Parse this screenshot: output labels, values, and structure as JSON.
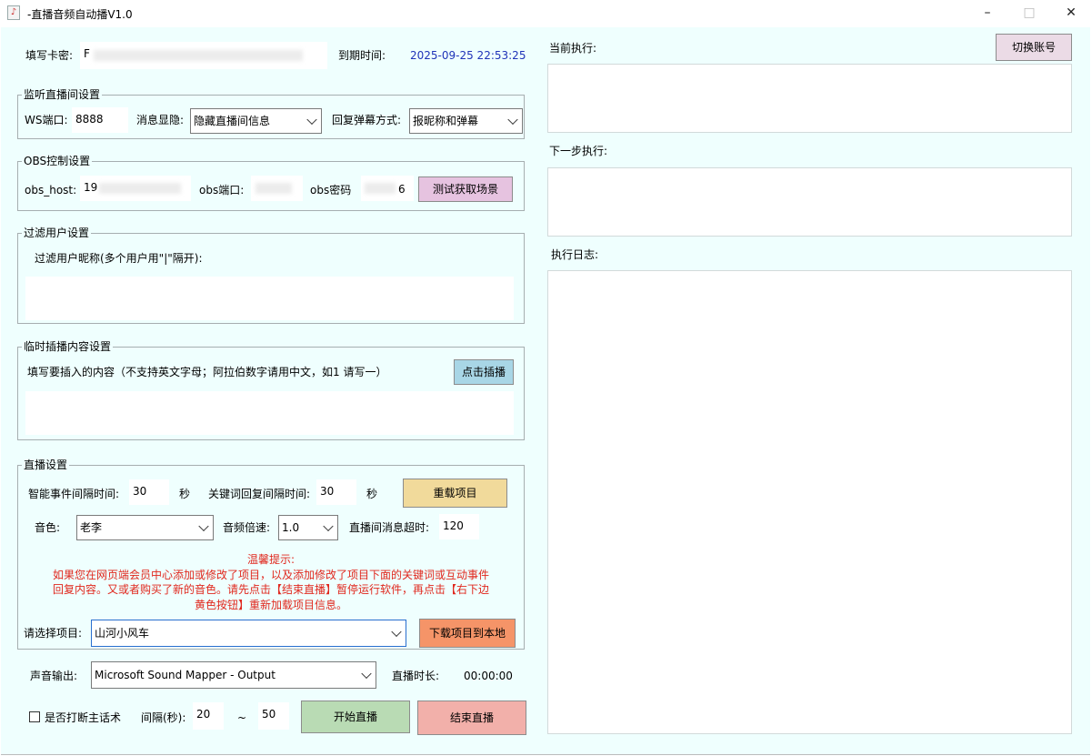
{
  "window": {
    "title": "-直播音频自动播V1.0",
    "minimize_glyph": "–",
    "maximize_glyph": "□",
    "close_glyph": "✕"
  },
  "top": {
    "card_label": "填写卡密:",
    "card_value": "F",
    "expiry_label": "到期时间:",
    "expiry_value": "2025-09-25 22:53:25"
  },
  "listen": {
    "legend": "监听直播间设置",
    "ws_label": "WS端口:",
    "ws_value": "8888",
    "privacy_label": "消息显隐:",
    "privacy_value": "隐藏直播间信息",
    "reply_label": "回复弹幕方式:",
    "reply_value": "报昵称和弹幕"
  },
  "obs": {
    "legend": "OBS控制设置",
    "host_label": "obs_host:",
    "host_value": "19",
    "port_label": "obs端口:",
    "port_value": "",
    "pwd_label": "obs密码",
    "pwd_value": "6",
    "test_button": "测试获取场景"
  },
  "filter": {
    "legend": "过滤用户设置",
    "hint": "过滤用户昵称(多个用户用\"|\"隔开):",
    "value": ""
  },
  "insert": {
    "legend": "临时插播内容设置",
    "hint": "填写要插入的内容（不支持英文字母；阿拉伯数字请用中文，如1 请写一）",
    "button": "点击插播",
    "value": ""
  },
  "live": {
    "legend": "直播设置",
    "event_interval_label": "智能事件间隔时间:",
    "event_interval_value": "30",
    "sec1": "秒",
    "kw_interval_label": "关键词回复间隔时间:",
    "kw_interval_value": "30",
    "sec2": "秒",
    "reload_button": "重载项目",
    "voice_label": "音色:",
    "voice_value": "老李",
    "speed_label": "音频倍速:",
    "speed_value": "1.0",
    "timeout_label": "直播间消息超时:",
    "timeout_value": "120",
    "tip_title": "温馨提示:",
    "tip_line1": "如果您在网页端会员中心添加或修改了项目，以及添加修改了项目下面的关键词或互动事件",
    "tip_line2": "回复内容。又或者购买了新的音色。请先点击【结束直播】暂停运行软件，再点击【右下边",
    "tip_line3": "黄色按钮】重新加载项目信息。",
    "project_label": "请选择项目:",
    "project_value": "山河小风车",
    "download_button": "下载项目到本地"
  },
  "bottom": {
    "audio_label": "声音输出:",
    "audio_value": "Microsoft Sound Mapper - Output",
    "duration_label": "直播时长:",
    "duration_value": "00:00:00",
    "interrupt_label": "是否打断主话术",
    "interval_label": "间隔(秒):",
    "interval_from": "20",
    "tilde": "~",
    "interval_to": "50",
    "start_button": "开始直播",
    "stop_button": "结束直播"
  },
  "right": {
    "switch_button": "切换账号",
    "current_label": "当前执行:",
    "current_value": "",
    "next_label": "下一步执行:",
    "next_value": "",
    "log_label": "执行日志:",
    "log_value": ""
  },
  "colors": {
    "client_bg": "#effffe",
    "expiry_text": "#1f33b8",
    "tip_text": "#e0281e",
    "test_button_bg": "#e6c3e0",
    "insert_button_bg": "#a8d6e6",
    "reload_button_bg": "#f1da9b",
    "download_button_bg": "#f59468",
    "start_button_bg": "#b9dbb4",
    "stop_button_bg": "#f2b0aa",
    "switch_button_bg": "#ebdbe6"
  }
}
